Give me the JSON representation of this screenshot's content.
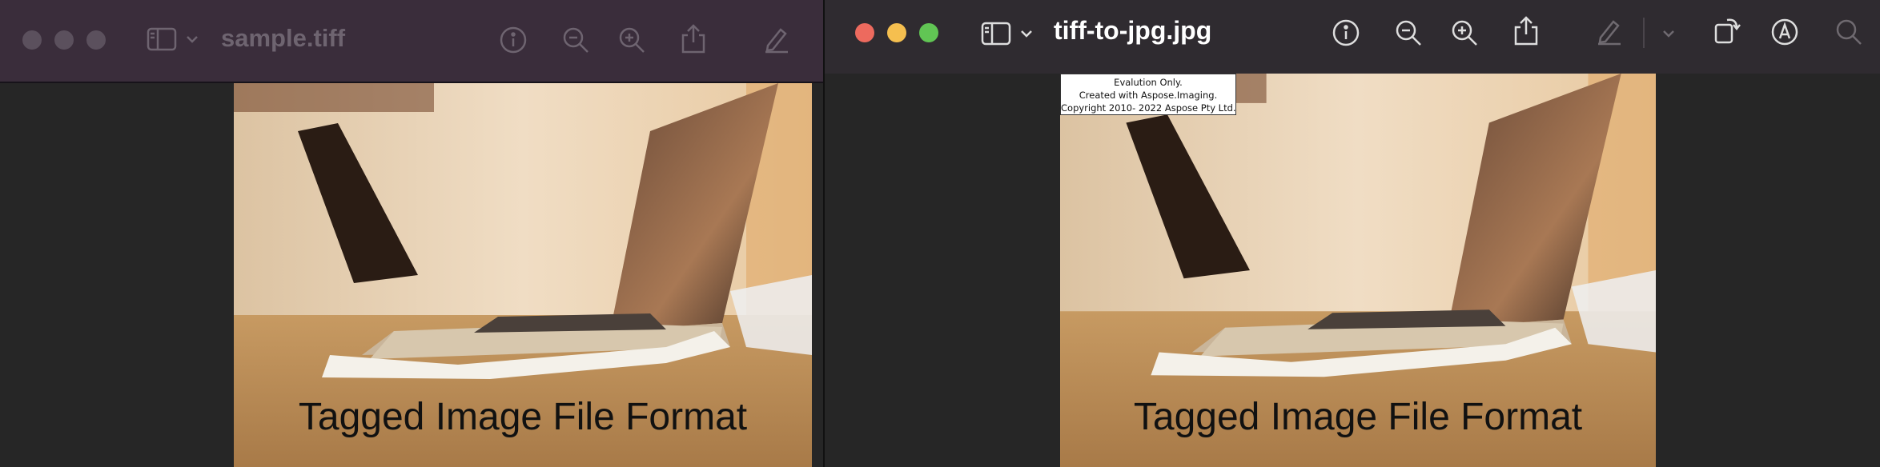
{
  "left_window": {
    "filename": "sample.tiff",
    "image_caption": "Tagged Image File Format",
    "toolbar_icons": [
      "sidebar-icon",
      "chevron-down-icon",
      "info-icon",
      "zoom-out-icon",
      "zoom-in-icon",
      "share-icon",
      "markup-pencil-icon"
    ]
  },
  "right_window": {
    "filename": "tiff-to-jpg.jpg",
    "image_caption": "Tagged Image File Format",
    "watermark": {
      "line1": "Evalution Only.",
      "line2": "Created with Aspose.Imaging.",
      "line3": "Copyright 2010- 2022 Aspose Pty Ltd."
    },
    "traffic_lights": {
      "close": "#ed6a5e",
      "minimize": "#f5bf4f",
      "zoom": "#61c554"
    },
    "toolbar_icons": [
      "sidebar-icon",
      "chevron-down-icon",
      "info-icon",
      "zoom-out-icon",
      "zoom-in-icon",
      "share-icon",
      "markup-pencil-icon",
      "chevron-down-icon",
      "rotate-icon",
      "markup-pen-icon",
      "search-icon"
    ]
  },
  "colors": {
    "left_titlebar": "#3a2d3b",
    "right_titlebar": "#2f2b30",
    "canvas": "#262626"
  }
}
